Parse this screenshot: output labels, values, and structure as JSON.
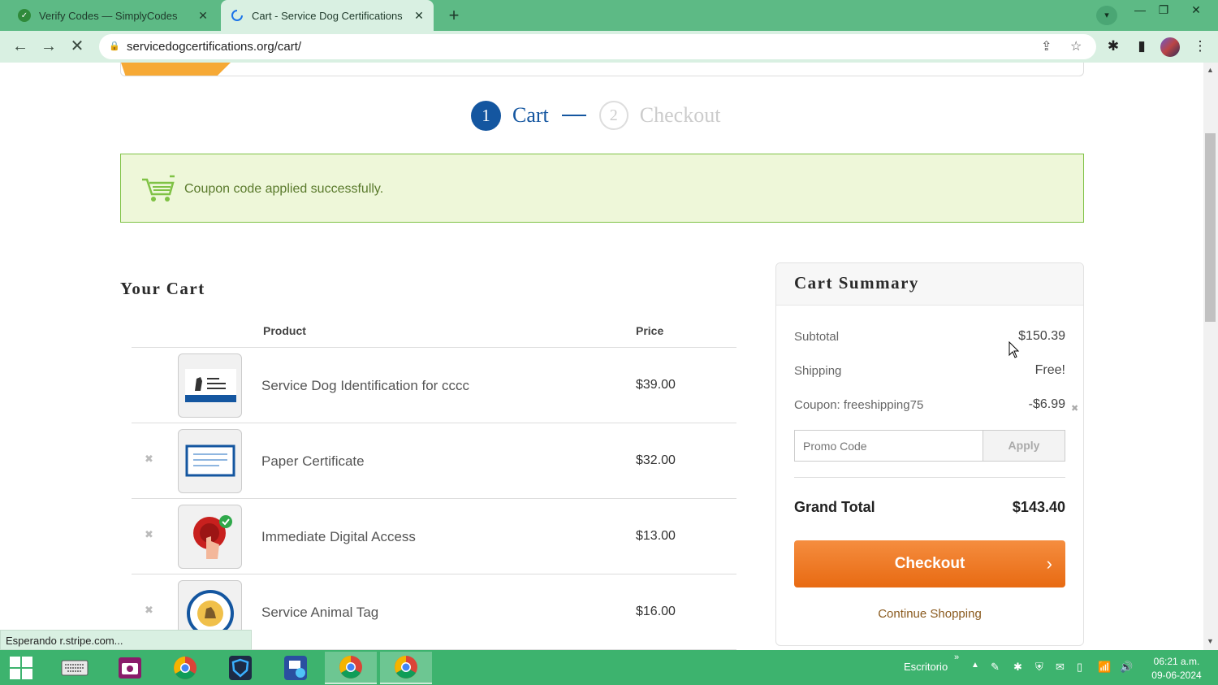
{
  "browser": {
    "tabs": [
      {
        "title": "Verify Codes — SimplyCodes",
        "active": false
      },
      {
        "title": "Cart - Service Dog Certifications",
        "active": true
      }
    ],
    "url": "servicedogcertifications.org/cart/",
    "status_text": "Esperando r.stripe.com..."
  },
  "steps": [
    {
      "number": "1",
      "label": "Cart",
      "active": true
    },
    {
      "number": "2",
      "label": "Checkout",
      "active": false
    }
  ],
  "notice": {
    "message": "Coupon code applied successfully."
  },
  "cart": {
    "title": "Your Cart",
    "columns": {
      "product": "Product",
      "price": "Price"
    },
    "items": [
      {
        "name": "Service Dog Identification for cccc",
        "price": "$39.00",
        "icon": "id-card-icon",
        "removable": false
      },
      {
        "name": "Paper Certificate",
        "price": "$32.00",
        "icon": "certificate-icon",
        "removable": true
      },
      {
        "name": "Immediate Digital Access",
        "price": "$13.00",
        "icon": "digital-access-icon",
        "removable": true
      },
      {
        "name": "Service Animal Tag",
        "price": "$16.00",
        "icon": "animal-tag-icon",
        "removable": true
      }
    ]
  },
  "summary": {
    "title": "Cart Summary",
    "subtotal_label": "Subtotal",
    "subtotal": "$150.39",
    "shipping_label": "Shipping",
    "shipping": "Free!",
    "coupon_label": "Coupon: freeshipping75",
    "coupon_value": "-$6.99",
    "promo_placeholder": "Promo Code",
    "apply_label": "Apply",
    "grand_total_label": "Grand Total",
    "grand_total": "$143.40",
    "checkout_label": "Checkout",
    "continue_label": "Continue Shopping"
  },
  "taskbar": {
    "tray_label": "Escritorio",
    "time": "06:21 a.m.",
    "date": "09-06-2024"
  },
  "colors": {
    "accent_blue": "#1456a0",
    "checkout_orange": "#f07b20",
    "success_green": "#7fc245",
    "browser_green": "#5dba85"
  }
}
